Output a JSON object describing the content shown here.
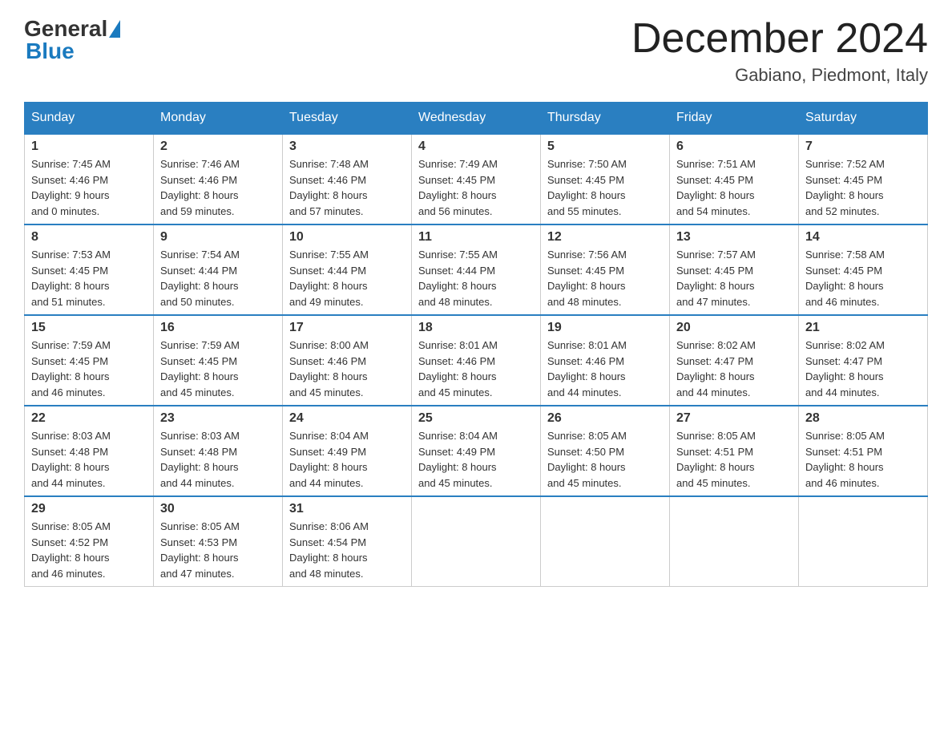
{
  "header": {
    "logo_general": "General",
    "logo_blue": "Blue",
    "month_title": "December 2024",
    "location": "Gabiano, Piedmont, Italy"
  },
  "days_of_week": [
    "Sunday",
    "Monday",
    "Tuesday",
    "Wednesday",
    "Thursday",
    "Friday",
    "Saturday"
  ],
  "weeks": [
    [
      {
        "day": "1",
        "sunrise": "7:45 AM",
        "sunset": "4:46 PM",
        "daylight": "9 hours and 0 minutes."
      },
      {
        "day": "2",
        "sunrise": "7:46 AM",
        "sunset": "4:46 PM",
        "daylight": "8 hours and 59 minutes."
      },
      {
        "day": "3",
        "sunrise": "7:48 AM",
        "sunset": "4:46 PM",
        "daylight": "8 hours and 57 minutes."
      },
      {
        "day": "4",
        "sunrise": "7:49 AM",
        "sunset": "4:45 PM",
        "daylight": "8 hours and 56 minutes."
      },
      {
        "day": "5",
        "sunrise": "7:50 AM",
        "sunset": "4:45 PM",
        "daylight": "8 hours and 55 minutes."
      },
      {
        "day": "6",
        "sunrise": "7:51 AM",
        "sunset": "4:45 PM",
        "daylight": "8 hours and 54 minutes."
      },
      {
        "day": "7",
        "sunrise": "7:52 AM",
        "sunset": "4:45 PM",
        "daylight": "8 hours and 52 minutes."
      }
    ],
    [
      {
        "day": "8",
        "sunrise": "7:53 AM",
        "sunset": "4:45 PM",
        "daylight": "8 hours and 51 minutes."
      },
      {
        "day": "9",
        "sunrise": "7:54 AM",
        "sunset": "4:44 PM",
        "daylight": "8 hours and 50 minutes."
      },
      {
        "day": "10",
        "sunrise": "7:55 AM",
        "sunset": "4:44 PM",
        "daylight": "8 hours and 49 minutes."
      },
      {
        "day": "11",
        "sunrise": "7:55 AM",
        "sunset": "4:44 PM",
        "daylight": "8 hours and 48 minutes."
      },
      {
        "day": "12",
        "sunrise": "7:56 AM",
        "sunset": "4:45 PM",
        "daylight": "8 hours and 48 minutes."
      },
      {
        "day": "13",
        "sunrise": "7:57 AM",
        "sunset": "4:45 PM",
        "daylight": "8 hours and 47 minutes."
      },
      {
        "day": "14",
        "sunrise": "7:58 AM",
        "sunset": "4:45 PM",
        "daylight": "8 hours and 46 minutes."
      }
    ],
    [
      {
        "day": "15",
        "sunrise": "7:59 AM",
        "sunset": "4:45 PM",
        "daylight": "8 hours and 46 minutes."
      },
      {
        "day": "16",
        "sunrise": "7:59 AM",
        "sunset": "4:45 PM",
        "daylight": "8 hours and 45 minutes."
      },
      {
        "day": "17",
        "sunrise": "8:00 AM",
        "sunset": "4:46 PM",
        "daylight": "8 hours and 45 minutes."
      },
      {
        "day": "18",
        "sunrise": "8:01 AM",
        "sunset": "4:46 PM",
        "daylight": "8 hours and 45 minutes."
      },
      {
        "day": "19",
        "sunrise": "8:01 AM",
        "sunset": "4:46 PM",
        "daylight": "8 hours and 44 minutes."
      },
      {
        "day": "20",
        "sunrise": "8:02 AM",
        "sunset": "4:47 PM",
        "daylight": "8 hours and 44 minutes."
      },
      {
        "day": "21",
        "sunrise": "8:02 AM",
        "sunset": "4:47 PM",
        "daylight": "8 hours and 44 minutes."
      }
    ],
    [
      {
        "day": "22",
        "sunrise": "8:03 AM",
        "sunset": "4:48 PM",
        "daylight": "8 hours and 44 minutes."
      },
      {
        "day": "23",
        "sunrise": "8:03 AM",
        "sunset": "4:48 PM",
        "daylight": "8 hours and 44 minutes."
      },
      {
        "day": "24",
        "sunrise": "8:04 AM",
        "sunset": "4:49 PM",
        "daylight": "8 hours and 44 minutes."
      },
      {
        "day": "25",
        "sunrise": "8:04 AM",
        "sunset": "4:49 PM",
        "daylight": "8 hours and 45 minutes."
      },
      {
        "day": "26",
        "sunrise": "8:05 AM",
        "sunset": "4:50 PM",
        "daylight": "8 hours and 45 minutes."
      },
      {
        "day": "27",
        "sunrise": "8:05 AM",
        "sunset": "4:51 PM",
        "daylight": "8 hours and 45 minutes."
      },
      {
        "day": "28",
        "sunrise": "8:05 AM",
        "sunset": "4:51 PM",
        "daylight": "8 hours and 46 minutes."
      }
    ],
    [
      {
        "day": "29",
        "sunrise": "8:05 AM",
        "sunset": "4:52 PM",
        "daylight": "8 hours and 46 minutes."
      },
      {
        "day": "30",
        "sunrise": "8:05 AM",
        "sunset": "4:53 PM",
        "daylight": "8 hours and 47 minutes."
      },
      {
        "day": "31",
        "sunrise": "8:06 AM",
        "sunset": "4:54 PM",
        "daylight": "8 hours and 48 minutes."
      },
      null,
      null,
      null,
      null
    ]
  ]
}
